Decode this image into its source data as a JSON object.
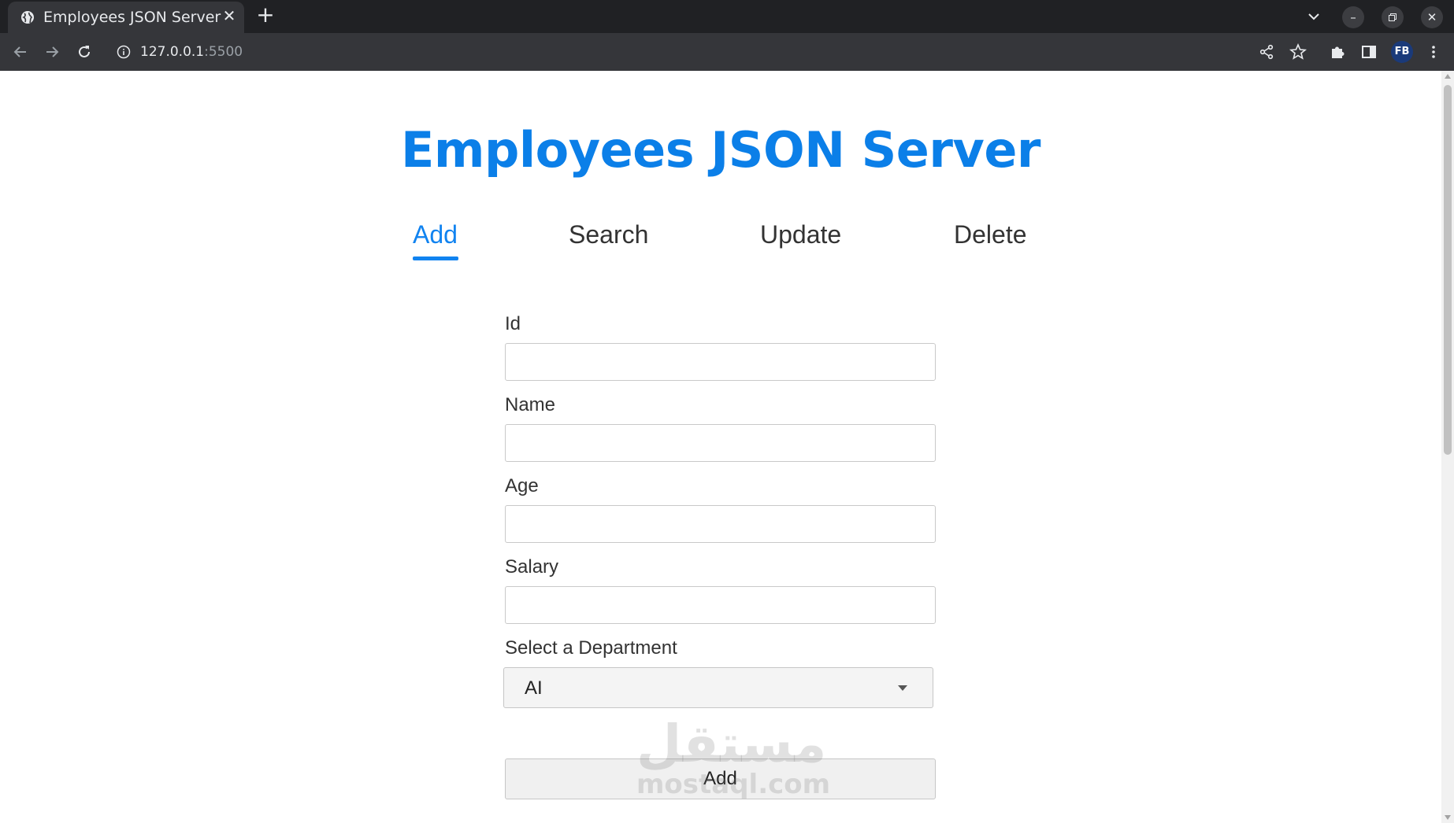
{
  "browser": {
    "tab_title": "Employees JSON Server",
    "url_host": "127.0.0.1",
    "url_port": ":5500",
    "profile_initials": "FB"
  },
  "page": {
    "title": "Employees JSON Server",
    "nav": {
      "active": "Add",
      "tabs": [
        "Add",
        "Search",
        "Update",
        "Delete"
      ]
    },
    "form": {
      "fields": [
        {
          "label": "Id",
          "value": ""
        },
        {
          "label": "Name",
          "value": ""
        },
        {
          "label": "Age",
          "value": ""
        },
        {
          "label": "Salary",
          "value": ""
        }
      ],
      "department_label": "Select a Department",
      "department_selected": "AI",
      "submit_label": "Add"
    },
    "watermark": {
      "arabic": "مستقل",
      "latin": "mostaql.com"
    }
  },
  "colors": {
    "accent": "#0b7fe8",
    "chrome_dark": "#202124",
    "chrome_toolbar": "#35363a"
  },
  "icons": [
    "globe-icon",
    "close-icon",
    "plus-icon",
    "chevron-down-icon",
    "minimize-icon",
    "restore-icon",
    "back-icon",
    "forward-icon",
    "reload-icon",
    "info-icon",
    "share-icon",
    "star-icon",
    "puzzle-icon",
    "side-panel-icon",
    "kebab-menu-icon",
    "caret-down-icon"
  ]
}
